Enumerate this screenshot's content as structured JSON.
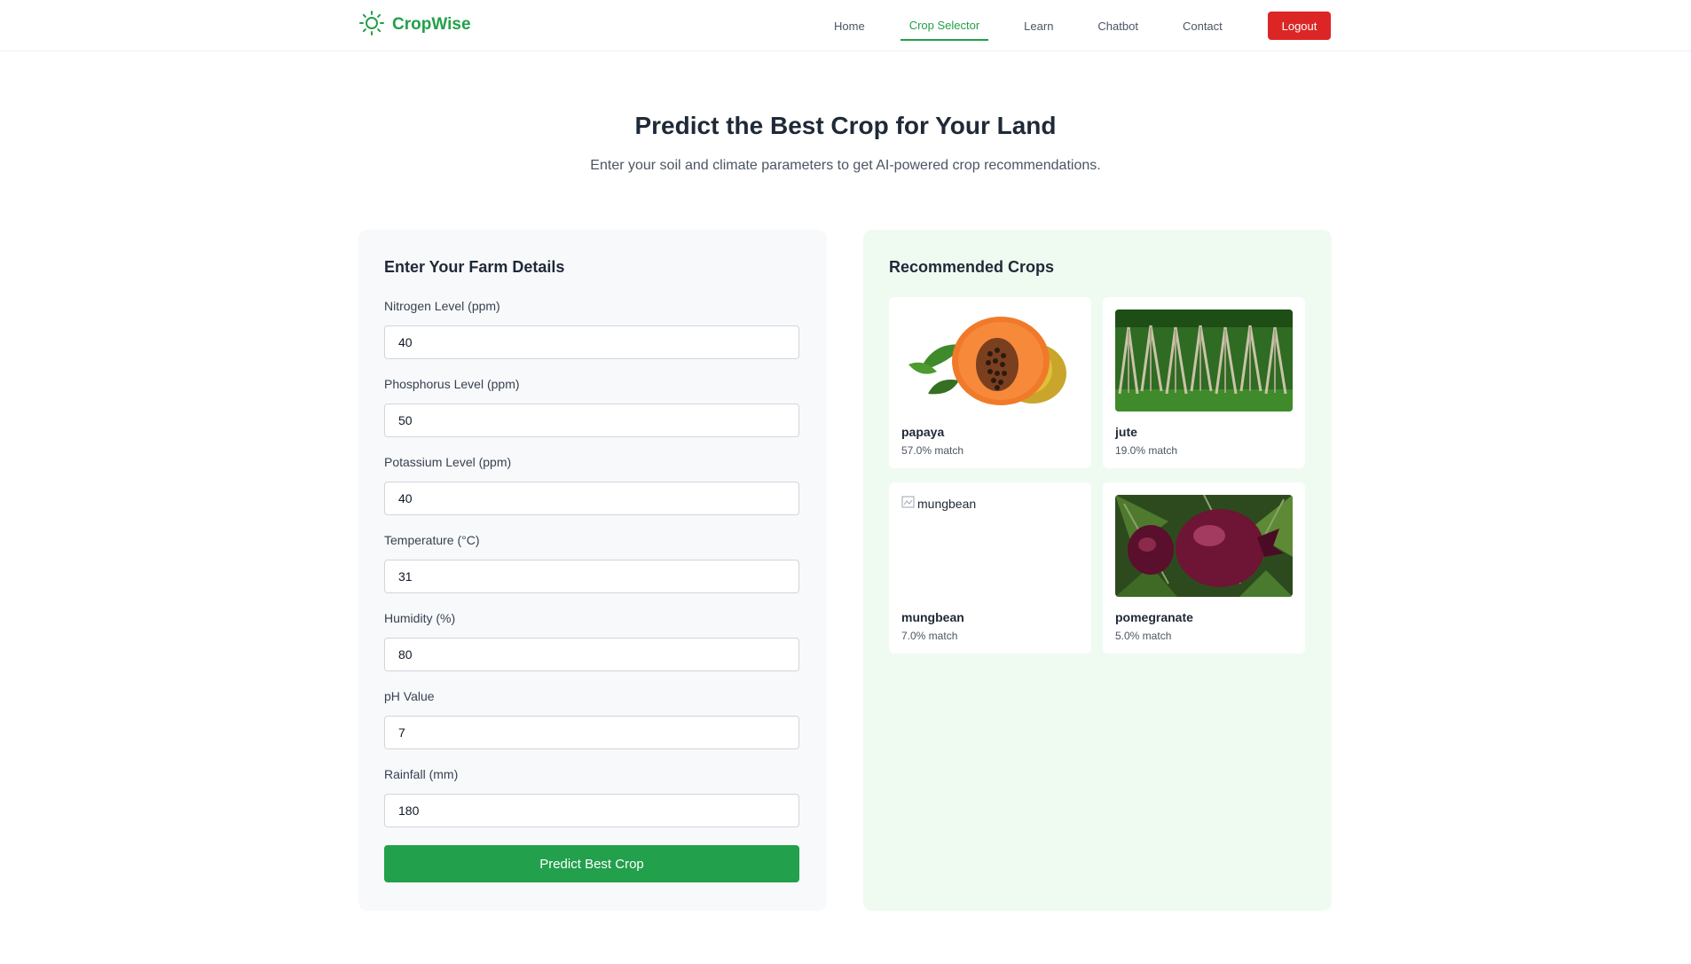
{
  "nav": {
    "brand": "CropWise",
    "links": [
      "Home",
      "Crop Selector",
      "Learn",
      "Chatbot",
      "Contact"
    ],
    "active": "Crop Selector",
    "logout": "Logout"
  },
  "hero": {
    "title": "Predict the Best Crop for Your Land",
    "subtitle": "Enter your soil and climate parameters to get AI-powered crop recommendations."
  },
  "form": {
    "title": "Enter Your Farm Details",
    "fields": [
      {
        "label": "Nitrogen Level (ppm)",
        "value": "40"
      },
      {
        "label": "Phosphorus Level (ppm)",
        "value": "50"
      },
      {
        "label": "Potassium Level (ppm)",
        "value": "40"
      },
      {
        "label": "Temperature (°C)",
        "value": "31"
      },
      {
        "label": "Humidity (%)",
        "value": "80"
      },
      {
        "label": "pH Value",
        "value": "7"
      },
      {
        "label": "Rainfall (mm)",
        "value": "180"
      }
    ],
    "submit": "Predict Best Crop"
  },
  "results": {
    "title": "Recommended Crops",
    "crops": [
      {
        "name": "papaya",
        "match": "57.0% match"
      },
      {
        "name": "jute",
        "match": "19.0% match"
      },
      {
        "name": "mungbean",
        "match": "7.0% match",
        "alt": "mungbean"
      },
      {
        "name": "pomegranate",
        "match": "5.0% match"
      }
    ]
  },
  "colors": {
    "brand": "#22a04b",
    "logout": "#dc2626",
    "results_bg": "#effbf1",
    "form_bg": "#f8f9fb"
  }
}
